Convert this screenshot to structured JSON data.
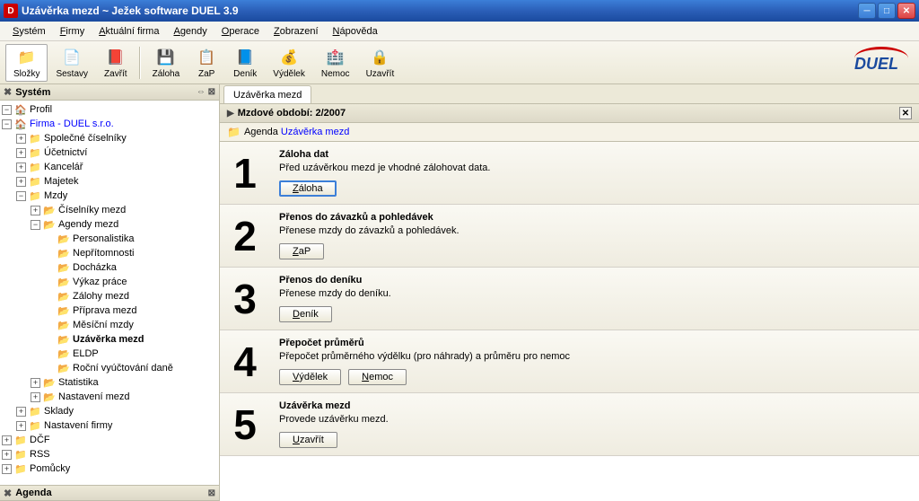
{
  "window": {
    "title": "Uzávěrka mezd ~ Ježek software DUEL 3.9",
    "appicon": "D"
  },
  "menu": {
    "items": [
      "Systém",
      "Firmy",
      "Aktuální firma",
      "Agendy",
      "Operace",
      "Zobrazení",
      "Nápověda"
    ]
  },
  "toolbar": {
    "items": [
      {
        "label": "Složky",
        "icon": "📁"
      },
      {
        "label": "Sestavy",
        "icon": "📄"
      },
      {
        "label": "Zavřít",
        "icon": "📕"
      },
      {
        "label": "Záloha",
        "icon": "💾"
      },
      {
        "label": "ZaP",
        "icon": "📋"
      },
      {
        "label": "Deník",
        "icon": "📘"
      },
      {
        "label": "Výdělek",
        "icon": "💰"
      },
      {
        "label": "Nemoc",
        "icon": "🏥"
      },
      {
        "label": "Uzavřít",
        "icon": "🔒"
      }
    ],
    "logo": "DUEL"
  },
  "leftpanel": {
    "header": "Systém",
    "bottom": "Agenda"
  },
  "tree": {
    "root": [
      {
        "exp": "-",
        "icon": "🏠",
        "label": "Profil",
        "link": false
      },
      {
        "exp": "-",
        "icon": "🏠",
        "label": "Firma - DUEL s.r.o.",
        "link": true,
        "children": [
          {
            "exp": "+",
            "icon": "📁",
            "label": "Společné číselníky"
          },
          {
            "exp": "+",
            "icon": "📁",
            "label": "Účetnictví"
          },
          {
            "exp": "+",
            "icon": "📁",
            "label": "Kancelář"
          },
          {
            "exp": "+",
            "icon": "📁",
            "label": "Majetek"
          },
          {
            "exp": "-",
            "icon": "📁",
            "label": "Mzdy",
            "children": [
              {
                "exp": "+",
                "icon": "📂",
                "label": "Číselníky mezd"
              },
              {
                "exp": "-",
                "icon": "📂",
                "label": "Agendy mezd",
                "children": [
                  {
                    "exp": "",
                    "icon": "📂",
                    "label": "Personalistika"
                  },
                  {
                    "exp": "",
                    "icon": "📂",
                    "label": "Nepřítomnosti"
                  },
                  {
                    "exp": "",
                    "icon": "📂",
                    "label": "Docházka"
                  },
                  {
                    "exp": "",
                    "icon": "📂",
                    "label": "Výkaz práce"
                  },
                  {
                    "exp": "",
                    "icon": "📂",
                    "label": "Zálohy mezd"
                  },
                  {
                    "exp": "",
                    "icon": "📂",
                    "label": "Příprava mezd"
                  },
                  {
                    "exp": "",
                    "icon": "📂",
                    "label": "Měsíční mzdy"
                  },
                  {
                    "exp": "",
                    "icon": "📂",
                    "label": "Uzávěrka mezd",
                    "bold": true
                  },
                  {
                    "exp": "",
                    "icon": "📂",
                    "label": "ELDP"
                  },
                  {
                    "exp": "",
                    "icon": "📂",
                    "label": "Roční vyúčtování daně"
                  }
                ]
              },
              {
                "exp": "+",
                "icon": "📂",
                "label": "Statistika"
              },
              {
                "exp": "+",
                "icon": "📂",
                "label": "Nastavení mezd"
              }
            ]
          },
          {
            "exp": "+",
            "icon": "📁",
            "label": "Sklady"
          },
          {
            "exp": "+",
            "icon": "📁",
            "label": "Nastavení firmy"
          }
        ]
      },
      {
        "exp": "+",
        "icon": "📁",
        "label": "DČF"
      },
      {
        "exp": "+",
        "icon": "📁",
        "label": "RSS"
      },
      {
        "exp": "+",
        "icon": "📁",
        "label": "Pomůcky"
      }
    ]
  },
  "tabs": {
    "active": "Uzávěrka mezd"
  },
  "subheader": {
    "label": "Mzdové období: 2/2007"
  },
  "agendaline": {
    "prefix": "Agenda",
    "link": "Uzávěrka mezd"
  },
  "steps": [
    {
      "num": "1",
      "title": "Záloha dat",
      "desc": "Před uzávěrkou mezd je vhodné zálohovat data.",
      "btns": [
        {
          "label": "Záloha",
          "u": 0,
          "focused": true
        }
      ]
    },
    {
      "num": "2",
      "title": "Přenos do závazků a pohledávek",
      "desc": "Přenese mzdy do závazků a pohledávek.",
      "btns": [
        {
          "label": "ZaP",
          "u": 0
        }
      ]
    },
    {
      "num": "3",
      "title": "Přenos do deníku",
      "desc": "Přenese mzdy do deníku.",
      "btns": [
        {
          "label": "Deník",
          "u": 0
        }
      ]
    },
    {
      "num": "4",
      "title": "Přepočet průměrů",
      "desc": "Přepočet průměrného výdělku (pro náhrady) a průměru pro nemoc",
      "btns": [
        {
          "label": "Výdělek",
          "u": 0
        },
        {
          "label": "Nemoc",
          "u": 0
        }
      ]
    },
    {
      "num": "5",
      "title": "Uzávěrka mezd",
      "desc": "Provede uzávěrku mezd.",
      "btns": [
        {
          "label": "Uzavřít",
          "u": 0
        }
      ]
    }
  ]
}
